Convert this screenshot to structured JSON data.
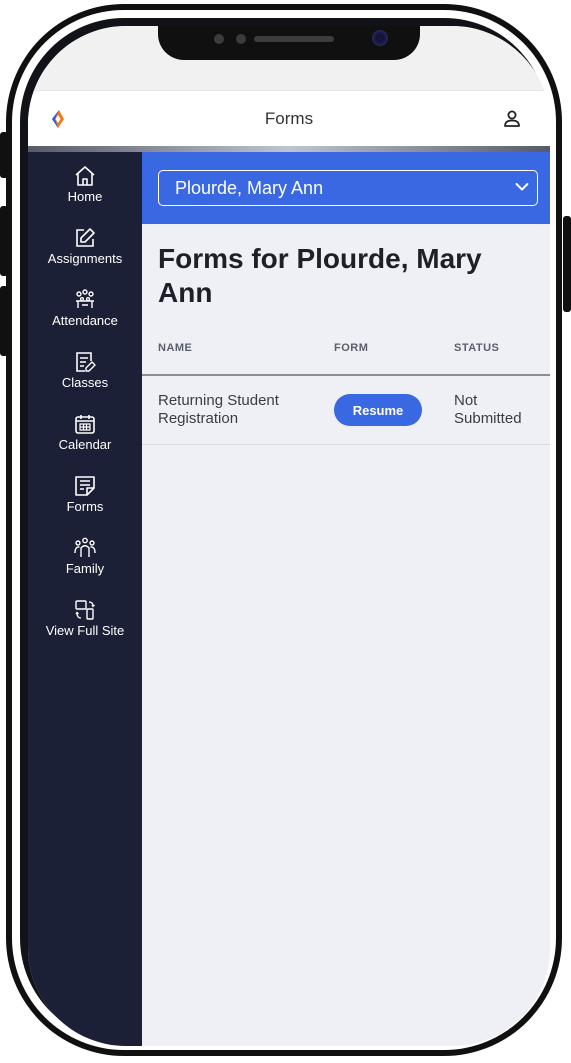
{
  "header": {
    "title": "Forms"
  },
  "sidebar": {
    "items": [
      {
        "label": "Home"
      },
      {
        "label": "Assignments"
      },
      {
        "label": "Attendance"
      },
      {
        "label": "Classes"
      },
      {
        "label": "Calendar"
      },
      {
        "label": "Forms"
      },
      {
        "label": "Family"
      },
      {
        "label": "View Full Site"
      }
    ]
  },
  "student_selector": {
    "selected": "Plourde, Mary Ann"
  },
  "page": {
    "heading": "Forms for Plourde, Mary Ann"
  },
  "table": {
    "columns": [
      "NAME",
      "FORM",
      "STATUS"
    ],
    "rows": [
      {
        "name": "Returning Student Registration",
        "action": "Resume",
        "status": "Not Submitted"
      }
    ]
  },
  "colors": {
    "accent": "#3a68e3",
    "sidebar": "#1c2036",
    "background": "#eef0f5"
  }
}
